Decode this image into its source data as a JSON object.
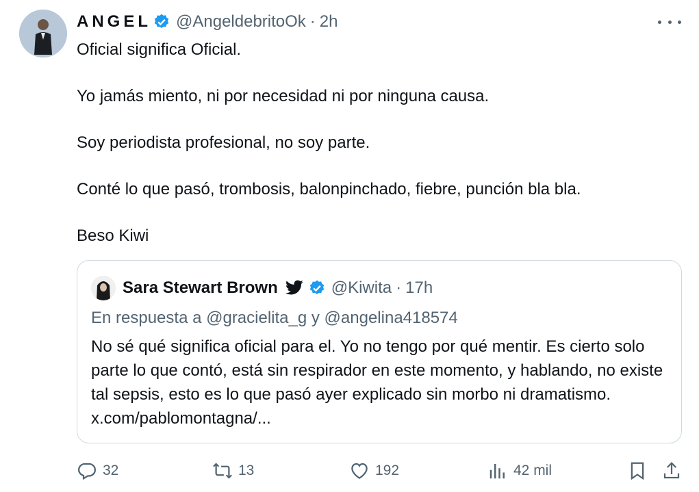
{
  "author": {
    "name": "ANGEL",
    "handle": "@AngeldebritoOk",
    "separator": "·",
    "time": "2h"
  },
  "tweet": {
    "paragraphs": [
      "Oficial significa Oficial.",
      "Yo jamás miento, ni por necesidad ni por ninguna causa.",
      "Soy periodista profesional, no soy parte.",
      "Conté lo que pasó, trombosis, balonpinchado, fiebre, punción bla bla.",
      "Beso Kiwi"
    ]
  },
  "quote": {
    "name": "Sara Stewart Brown",
    "handle": "@Kiwita",
    "separator": "·",
    "time": "17h",
    "reply_prefix": "En respuesta a @gracielita_g y @angelina418574",
    "text": "No sé qué significa oficial para el. Yo no tengo por qué mentir. Es cierto solo parte lo que contó, está sin respirador en este momento, y hablando, no existe tal sepsis, esto es lo que pasó ayer explicado sin morbo ni dramatismo. x.com/pablomontagna/..."
  },
  "actions": {
    "replies": "32",
    "reposts": "13",
    "likes": "192",
    "views": "42 mil"
  },
  "colors": {
    "verified_blue": "#1d9bf0",
    "muted_text": "#536471",
    "border": "#cfd9de"
  },
  "icons": [
    "verified-icon",
    "more-icon",
    "bird-icon",
    "reply-icon",
    "repost-icon",
    "like-icon",
    "views-icon",
    "bookmark-icon",
    "share-icon"
  ]
}
